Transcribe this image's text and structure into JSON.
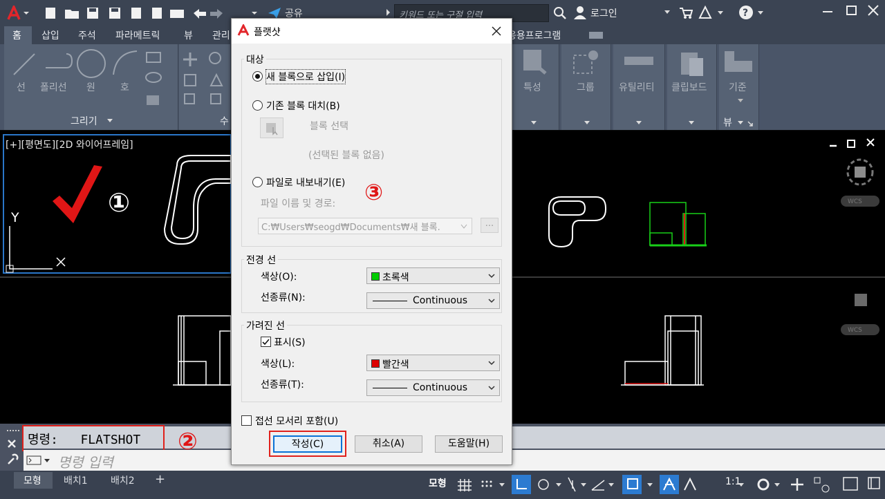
{
  "titlebar": {
    "share_label": "공유",
    "search_placeholder": "키워드 또는 구절 입력",
    "login_label": "로그인"
  },
  "ribbon_tabs": [
    "홈",
    "삽입",
    "주석",
    "파라메트릭",
    "뷰",
    "관리"
  ],
  "ribbon_tab_apps": "응용프로그램",
  "ribbon": {
    "draw_tools": [
      "선",
      "폴리선",
      "원",
      "호"
    ],
    "draw_panel_label": "그리기",
    "modify_panel_label_partial": "수",
    "right_tools": [
      "특성",
      "그룹",
      "유틸리티",
      "클립보드",
      "기준"
    ],
    "view_panel_label": "뷰"
  },
  "viewport": {
    "label": "[+][평면도][2D 와이어프레임]",
    "marker_1": "①",
    "marker_2": "②",
    "marker_3": "③",
    "wcs": "WCS",
    "axis_y": "Y"
  },
  "command": {
    "history": "명령:   FLATSHOT",
    "input_placeholder": "명령 입력"
  },
  "layout_tabs": [
    "모형",
    "배치1",
    "배치2"
  ],
  "status": {
    "model_label": "모형",
    "scale": "1:1"
  },
  "dialog": {
    "title": "플랫샷",
    "target_group": "대상",
    "opt_new_block": "새 블록으로 삽입(I)",
    "opt_replace_block": "기존 블록 대치(B)",
    "select_block": "블록 선택",
    "no_block": "(선택된 블록 없음)",
    "opt_export_file": "파일로 내보내기(E)",
    "file_path_label": "파일 이름 및 경로:",
    "file_path_value": "C:₩Users₩seogd₩Documents₩새 블록.",
    "browse": "...",
    "foreground_group": "전경 선",
    "fg_color_label": "색상(O):",
    "fg_color_value": "초록색",
    "fg_linetype_label": "선종류(N):",
    "fg_linetype_value": "Continuous",
    "obscured_group": "가려진 선",
    "show_label": "표시(S)",
    "ob_color_label": "색상(L):",
    "ob_color_value": "빨간색",
    "ob_linetype_label": "선종류(T):",
    "ob_linetype_value": "Continuous",
    "tangent_label": "접선 모서리 포함(U)",
    "btn_create": "작성(C)",
    "btn_cancel": "취소(A)",
    "btn_help": "도움말(H)",
    "colors": {
      "fg": "#00cc00",
      "ob": "#dd0000"
    }
  }
}
